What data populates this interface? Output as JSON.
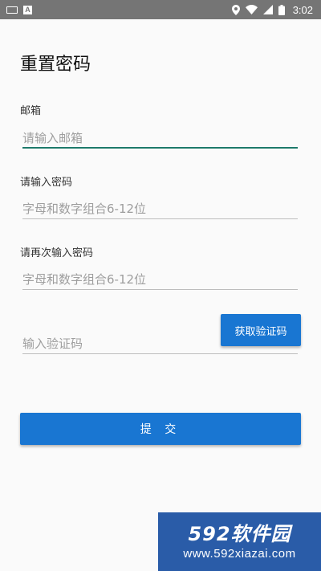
{
  "status_bar": {
    "time": "3:02",
    "left_icons": [
      "keyboard-icon",
      "a-notification-icon"
    ],
    "right_icons": [
      "location-icon",
      "wifi-icon",
      "signal-icon",
      "battery-icon"
    ]
  },
  "page": {
    "title": "重置密码"
  },
  "form": {
    "email": {
      "label": "邮箱",
      "placeholder": "请输入邮箱"
    },
    "password": {
      "label": "请输入密码",
      "placeholder": "字母和数字组合6-12位"
    },
    "confirm_password": {
      "label": "请再次输入密码",
      "placeholder": "字母和数字组合6-12位"
    },
    "verification": {
      "placeholder": "输入验证码",
      "button_label": "获取验证码"
    },
    "submit_label": "提 交"
  },
  "watermark": {
    "brand": "592软件园",
    "url": "www.592xiazai.com"
  },
  "colors": {
    "primary": "#1976d2",
    "active_underline": "#1d7a6b",
    "status_bar": "#757575",
    "background": "#fafafa",
    "watermark": "#2a5ca8"
  }
}
